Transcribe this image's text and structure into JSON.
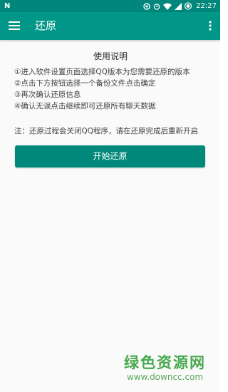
{
  "status_bar": {
    "left_label": "N",
    "time": "22:27",
    "icons": [
      "nfc-icon",
      "alarm-icon",
      "wifi-icon",
      "signal-icon",
      "battery-icon"
    ],
    "background": "#00867a"
  },
  "app_bar": {
    "title": "还原",
    "menu_icon": "hamburger-menu-icon",
    "more_icon": "more-vert-icon",
    "background": "#009688"
  },
  "instructions": {
    "title": "使用说明",
    "steps": [
      "①进入软件设置页面选择QQ版本为您需要还原的版本",
      "②点击下方按钮选择一个备份文件点击确定",
      "③再次确认还原信息",
      "④确认无误点击继续即可还原所有聊天数据"
    ],
    "note": "注：还原过程会关闭QQ程序，请在还原完成后重新开启"
  },
  "action": {
    "start_label": "开始还原",
    "button_color": "#00897b"
  },
  "watermark": {
    "text": "绿色资源网",
    "url": "www.downcc.com",
    "color": "#48a94e"
  }
}
